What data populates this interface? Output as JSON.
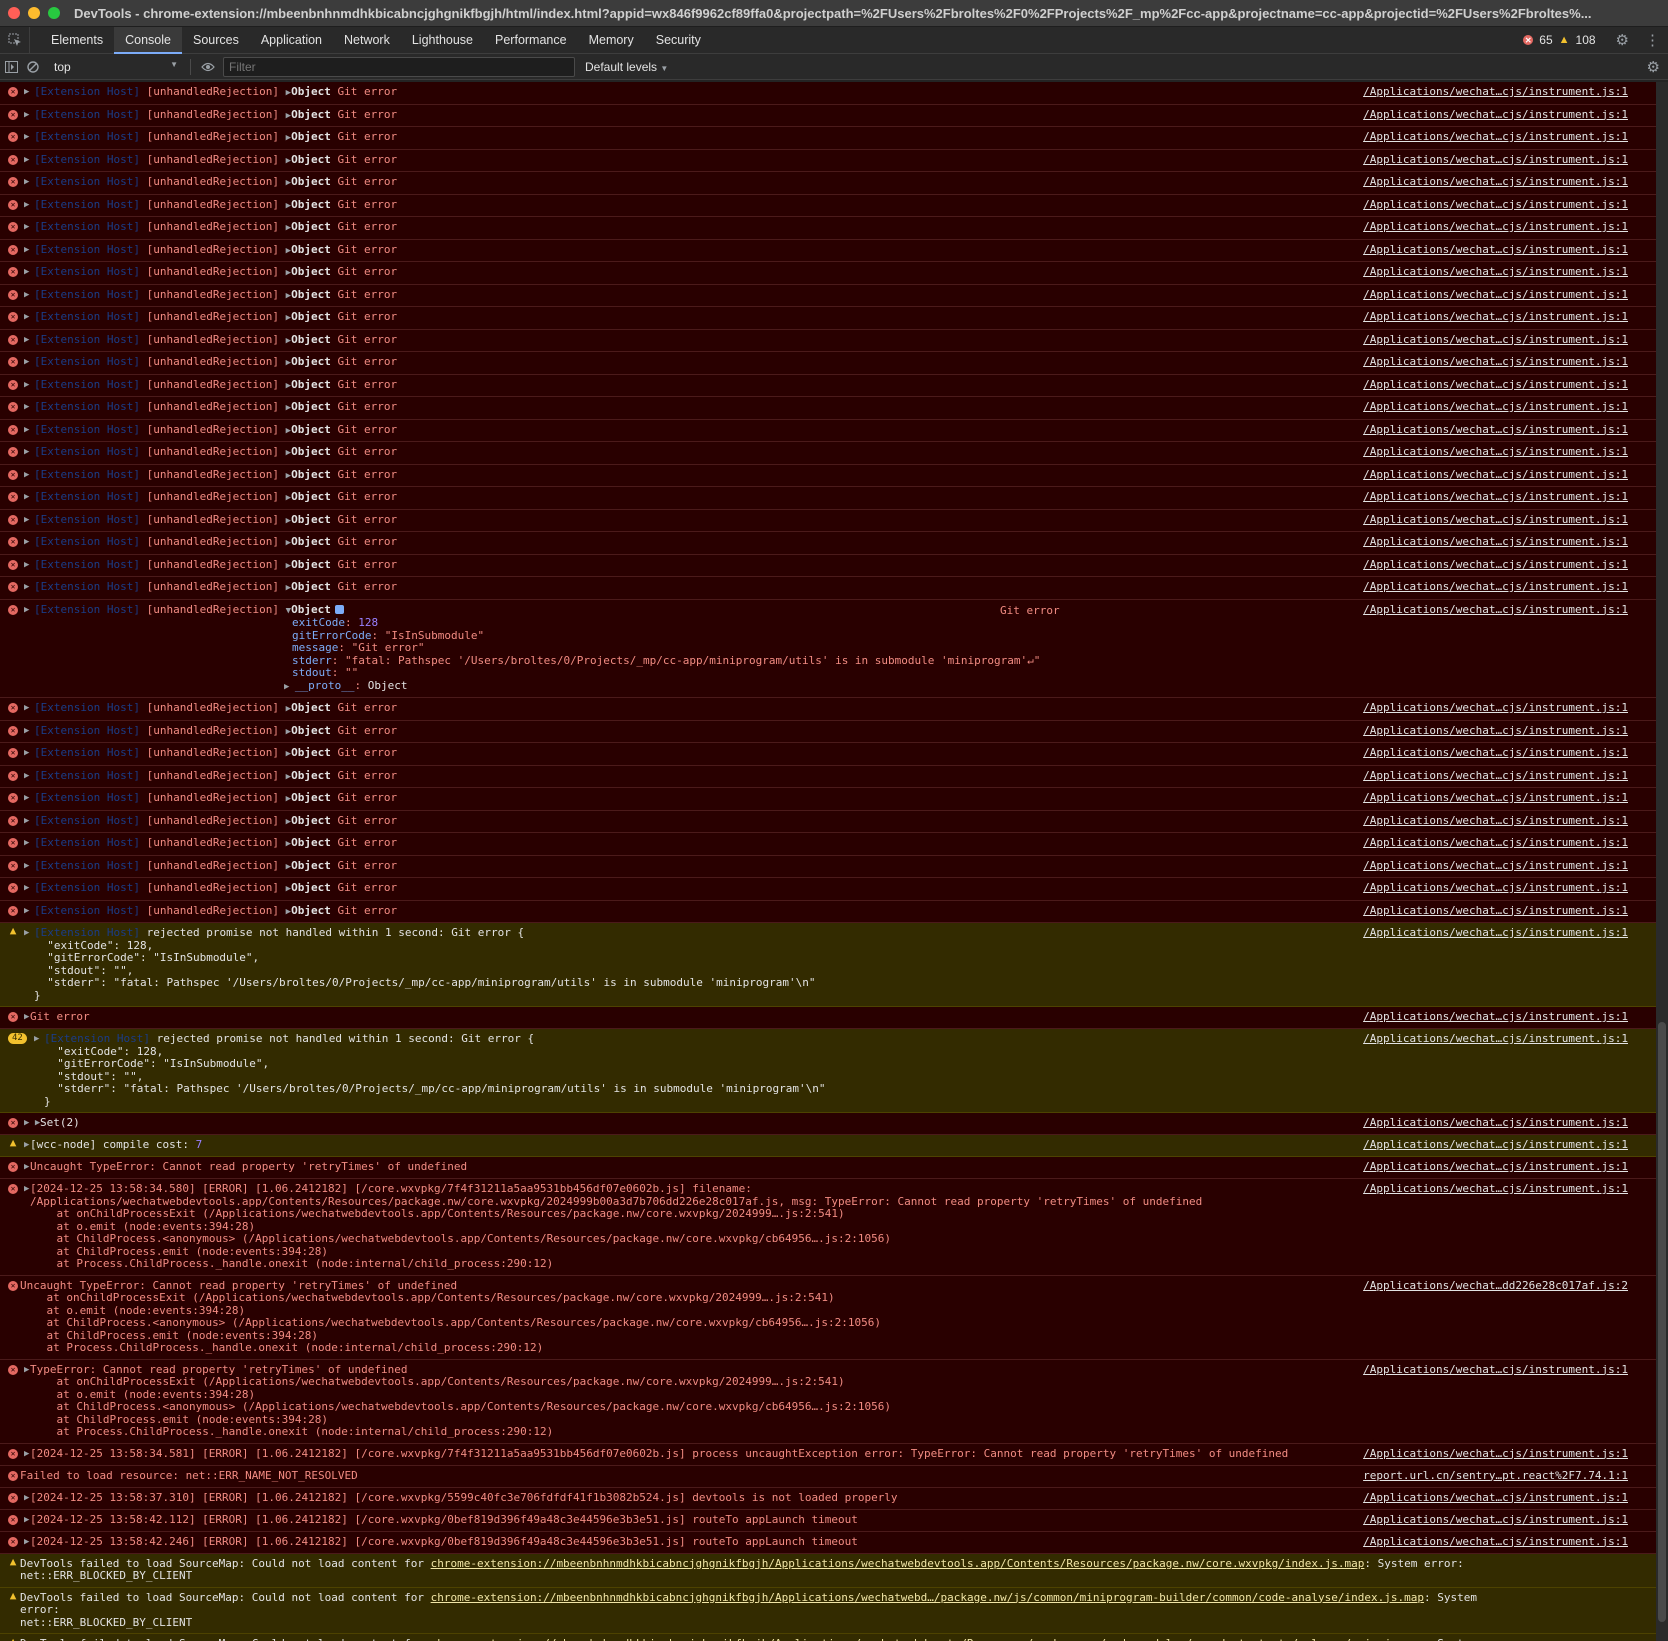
{
  "window": {
    "title": "DevTools - chrome-extension://mbeenbnhnmdhkbicabncjghgnikfbgjh/html/index.html?appid=wx846f9962cf89ffa0&projectpath=%2FUsers%2Fbroltes%2F0%2FProjects%2F_mp%2Fcc-app&projectname=cc-app&projectid=%2FUsers%2Fbroltes%..."
  },
  "tabs": [
    "Elements",
    "Console",
    "Sources",
    "Application",
    "Network",
    "Lighthouse",
    "Performance",
    "Memory",
    "Security"
  ],
  "counts": {
    "errors": "65",
    "warnings": "108"
  },
  "toolbar": {
    "context": "top",
    "filter_placeholder": "Filter",
    "levels": "Default levels"
  },
  "host": "[Extension Host]",
  "rejection": "[unhandledRejection]",
  "object_label": "Object",
  "git_error": "Git error",
  "source": "/Applications/wechat…cjs/instrument.js:1",
  "expanded": {
    "props": [
      {
        "k": "exitCode",
        "v": "128",
        "t": "num"
      },
      {
        "k": "gitErrorCode",
        "v": "\"IsInSubmodule\"",
        "t": "str"
      },
      {
        "k": "message",
        "v": "\"Git error\"",
        "t": "str"
      },
      {
        "k": "stderr",
        "v": "\"fatal: Pathspec '/Users/broltes/0/Projects/_mp/cc-app/miniprogram/utils' is in submodule 'miniprogram'↵\"",
        "t": "str"
      },
      {
        "k": "stdout",
        "v": "\"\"",
        "t": "str"
      },
      {
        "k": "__proto__",
        "v": "Object",
        "t": "obj"
      }
    ]
  },
  "warn1": {
    "text": "rejected promise not handled within 1 second: Git error {\n  \"exitCode\": 128,\n  \"gitErrorCode\": \"IsInSubmodule\",\n  \"stdout\": \"\",\n  \"stderr\": \"fatal: Pathspec '/Users/broltes/0/Projects/_mp/cc-app/miniprogram/utils' is in submodule 'miniprogram'\\n\"\n}"
  },
  "badge_count": "42",
  "set_label": "Set(2)",
  "wcc": {
    "label": "[wcc-node] compile cost:",
    "value": "7"
  },
  "typeerror_uncaught": "Uncaught TypeError: Cannot read property 'retryTimes' of undefined",
  "stack_err1": "[2024-12-25 13:58:34.580] [ERROR] [1.06.2412182] [/core.wxvpkg/7f4f31211a5aa9531bb456df07e0602b.js] filename:\n/Applications/wechatwebdevtools.app/Contents/Resources/package.nw/core.wxvpkg/2024999b00a3d7b706dd226e28c017af.js, msg: TypeError: Cannot read property 'retryTimes' of undefined\n    at onChildProcessExit (/Applications/wechatwebdevtools.app/Contents/Resources/package.nw/core.wxvpkg/2024999….js:2:541)\n    at o.emit (node:events:394:28)\n    at ChildProcess.<anonymous> (/Applications/wechatwebdevtools.app/Contents/Resources/package.nw/core.wxvpkg/cb64956….js:2:1056)\n    at ChildProcess.emit (node:events:394:28)\n    at Process.ChildProcess._handle.onexit (node:internal/child_process:290:12)",
  "stack_err2": "Uncaught TypeError: Cannot read property 'retryTimes' of undefined\n    at onChildProcessExit (/Applications/wechatwebdevtools.app/Contents/Resources/package.nw/core.wxvpkg/2024999….js:2:541)\n    at o.emit (node:events:394:28)\n    at ChildProcess.<anonymous> (/Applications/wechatwebdevtools.app/Contents/Resources/package.nw/core.wxvpkg/cb64956….js:2:1056)\n    at ChildProcess.emit (node:events:394:28)\n    at Process.ChildProcess._handle.onexit (node:internal/child_process:290:12)",
  "stack_err2_src": "/Applications/wechat…dd226e28c017af.js:2",
  "stack_err3": "TypeError: Cannot read property 'retryTimes' of undefined\n    at onChildProcessExit (/Applications/wechatwebdevtools.app/Contents/Resources/package.nw/core.wxvpkg/2024999….js:2:541)\n    at o.emit (node:events:394:28)\n    at ChildProcess.<anonymous> (/Applications/wechatwebdevtools.app/Contents/Resources/package.nw/core.wxvpkg/cb64956….js:2:1056)\n    at ChildProcess.emit (node:events:394:28)\n    at Process.ChildProcess._handle.onexit (node:internal/child_process:290:12)",
  "tail_errors": [
    {
      "text": "[2024-12-25 13:58:34.581] [ERROR] [1.06.2412182] [/core.wxvpkg/7f4f31211a5aa9531bb456df07e0602b.js] process uncaughtException error: TypeError: Cannot read property 'retryTimes' of undefined",
      "src": "/Applications/wechat…cjs/instrument.js:1",
      "tri": true
    },
    {
      "text": "Failed to load resource: net::ERR_NAME_NOT_RESOLVED",
      "src": "report.url.cn/sentry…pt.react%2F7.74.1:1",
      "tri": false
    },
    {
      "text": "[2024-12-25 13:58:37.310] [ERROR] [1.06.2412182] [/core.wxvpkg/5599c40fc3e706fdfdf41f1b3082b524.js] devtools is not loaded properly",
      "src": "/Applications/wechat…cjs/instrument.js:1",
      "tri": true
    },
    {
      "text": "[2024-12-25 13:58:42.112] [ERROR] [1.06.2412182] [/core.wxvpkg/0bef819d396f49a48c3e44596e3b3e51.js] routeTo appLaunch timeout",
      "src": "/Applications/wechat…cjs/instrument.js:1",
      "tri": true
    },
    {
      "text": "[2024-12-25 13:58:42.246] [ERROR] [1.06.2412182] [/core.wxvpkg/0bef819d396f49a48c3e44596e3b3e51.js] routeTo appLaunch timeout",
      "src": "/Applications/wechat…cjs/instrument.js:1",
      "tri": true
    }
  ],
  "sourcemap": [
    {
      "pre": "DevTools failed to load SourceMap: Could not load content for ",
      "link": "chrome-extension://mbeenbnhnmdhkbicabncjghgnikfbgjh/Applications/wechatwebdevtools.app/Contents/Resources/package.nw/core.wxvpkg/index.js.map",
      "post": ": System error:\nnet::ERR_BLOCKED_BY_CLIENT"
    },
    {
      "pre": "DevTools failed to load SourceMap: Could not load content for ",
      "link": "chrome-extension://mbeenbnhnmdhkbicabncjghgnikfbgjh/Applications/wechatwebd…/package.nw/js/common/miniprogram-builder/common/code-analyse/index.js.map",
      "post": ": System error:\nnet::ERR_BLOCKED_BY_CLIENT"
    },
    {
      "pre": "DevTools failed to load SourceMap: Could not load content for ",
      "link": "chrome-extension://mbeenbnhnmdhkbicabncjghgnikfbgjh/Applications/wechatwebd…ents/Resources/package.nw/node_modules/vscode-textmate/release/main.js.map",
      "post": ": System error:\nnet::ERR_BLOCKED_BY_CLIENT"
    }
  ],
  "prompt": "›",
  "colors": {
    "error_bg": "#290000",
    "warn_bg": "#332b00",
    "accent": "#7cacf8",
    "error": "#e46962",
    "warning": "#f2c12e"
  }
}
